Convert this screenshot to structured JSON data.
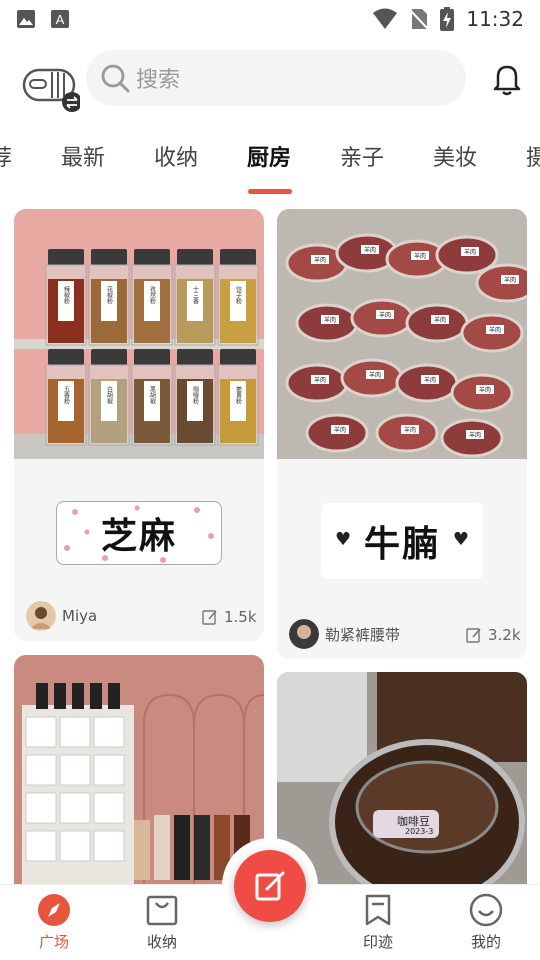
{
  "status_bar": {
    "time": "11:32",
    "icons": [
      "image-icon",
      "a-icon",
      "wifi-icon",
      "no-sim-icon",
      "battery-charging-icon"
    ]
  },
  "header": {
    "search_placeholder": "搜索",
    "icons": [
      "logo-switch-icon",
      "search-icon",
      "bell-icon"
    ]
  },
  "tabs": [
    {
      "label": "荐",
      "active": false
    },
    {
      "label": "最新",
      "active": false
    },
    {
      "label": "收纳",
      "active": false
    },
    {
      "label": "厨房",
      "active": true
    },
    {
      "label": "亲子",
      "active": false
    },
    {
      "label": "美妆",
      "active": false
    },
    {
      "label": "摄",
      "active": false
    }
  ],
  "feed": [
    {
      "author": "Miya",
      "count": "1.5k",
      "label": "芝麻"
    },
    {
      "author": "勒紧裤腰带",
      "count": "3.2k",
      "label": "牛腩"
    },
    {
      "author": "",
      "count": "",
      "label": ""
    },
    {
      "author": "",
      "count": "",
      "label": "咖啡豆",
      "sub": "2023-3"
    }
  ],
  "jar_labels_top": [
    "辣椒粉",
    "花椒粉",
    "孜然粉",
    "十三香",
    "饺子粉"
  ],
  "jar_labels_bottom": [
    "五香粉",
    "白胡椒",
    "黑胡椒",
    "咖喱粉",
    "姜黄粉"
  ],
  "meat_tag": "羊肉",
  "bottom_nav": [
    {
      "label": "广场",
      "icon": "compass-icon",
      "active": true
    },
    {
      "label": "收纳",
      "icon": "bag-icon",
      "active": false
    },
    {
      "label": "印迹",
      "icon": "bookmark-icon",
      "active": false
    },
    {
      "label": "我的",
      "icon": "smile-icon",
      "active": false
    }
  ],
  "colors": {
    "accent": "#e8553f",
    "fab": "#ee4c45",
    "card_bg": "#f5f5f5"
  }
}
